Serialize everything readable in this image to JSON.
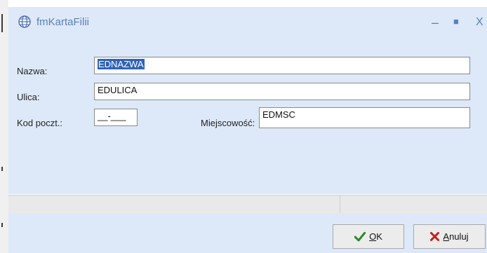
{
  "window": {
    "title": "fmKartaFilii"
  },
  "controls": {
    "minimize": "–",
    "maximize": "■",
    "close": "X"
  },
  "form": {
    "nazwa": {
      "label": "Nazwa:",
      "value": "EDNAZWA"
    },
    "ulica": {
      "label": "Ulica:",
      "value": "EDULICA"
    },
    "kod": {
      "label": "Kod poczt.:",
      "value": "__-___"
    },
    "miejscowosc": {
      "label": "Miejscowość:",
      "value": "EDMSC"
    }
  },
  "buttons": {
    "ok": {
      "accel": "O",
      "rest": "K"
    },
    "anuluj": {
      "accel": "A",
      "rest": "nuluj"
    }
  },
  "colors": {
    "titlebar": "#dde9f8",
    "accent": "#5b7fb8",
    "ok_check": "#2a8a2a",
    "cancel_x": "#c0201a"
  }
}
